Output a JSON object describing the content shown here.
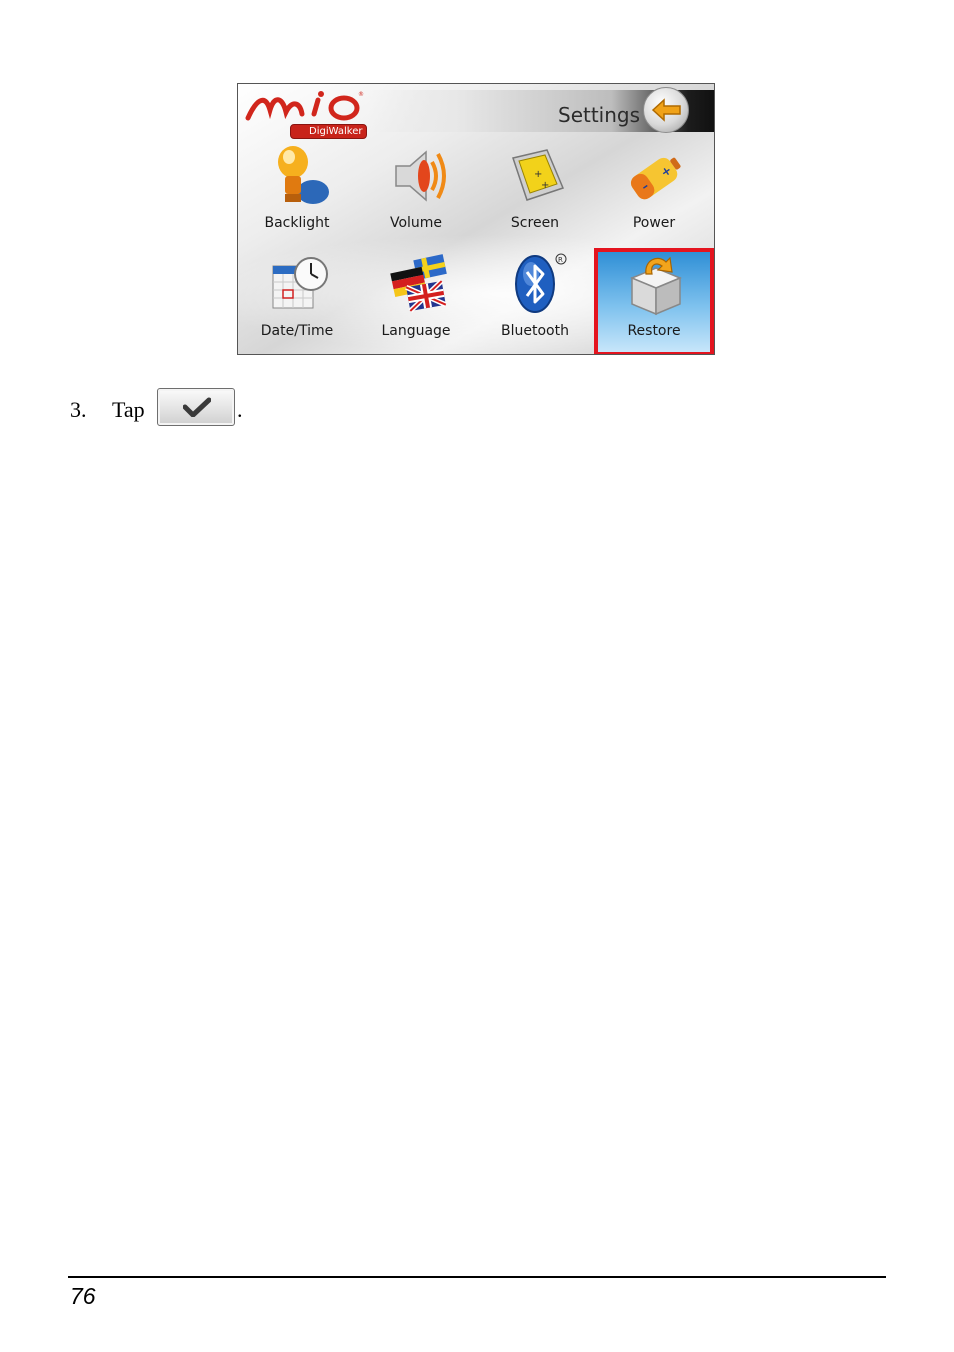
{
  "device": {
    "logo": "Mio",
    "logo_sub": "DigiWalker",
    "title": "Settings",
    "items": [
      {
        "label": "Backlight",
        "icon": "bulb-icon"
      },
      {
        "label": "Volume",
        "icon": "speaker-icon"
      },
      {
        "label": "Screen",
        "icon": "screen-icon"
      },
      {
        "label": "Power",
        "icon": "battery-icon"
      },
      {
        "label": "Date/Time",
        "icon": "calendar-clock-icon"
      },
      {
        "label": "Language",
        "icon": "flags-icon"
      },
      {
        "label": "Bluetooth",
        "icon": "bluetooth-icon"
      },
      {
        "label": "Restore",
        "icon": "restore-box-icon"
      }
    ],
    "selected": "Restore",
    "highlight_color": "#e4141f"
  },
  "step": {
    "number": "3.",
    "text": "Tap",
    "button_icon": "checkmark-icon",
    "trailing": "."
  },
  "footer": {
    "page_number": "76"
  }
}
